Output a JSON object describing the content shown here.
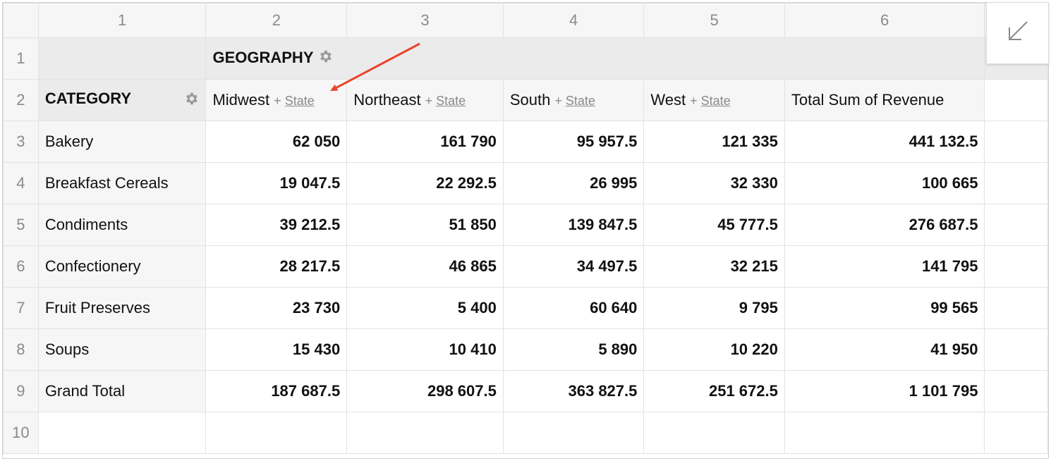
{
  "columns": [
    "1",
    "2",
    "3",
    "4",
    "5",
    "6"
  ],
  "rows": [
    "1",
    "2",
    "3",
    "4",
    "5",
    "6",
    "7",
    "8",
    "9",
    "10"
  ],
  "pivot": {
    "column_field": "GEOGRAPHY",
    "row_field": "CATEGORY",
    "column_headers": [
      {
        "label": "Midwest",
        "plus": "+",
        "sub": "State"
      },
      {
        "label": "Northeast",
        "plus": "+",
        "sub": "State"
      },
      {
        "label": "South",
        "plus": "+",
        "sub": "State"
      },
      {
        "label": "West",
        "plus": "+",
        "sub": "State"
      }
    ],
    "total_header": "Total Sum of Revenue",
    "data_rows": [
      {
        "label": "Bakery",
        "values": [
          "62 050",
          "161 790",
          "95 957.5",
          "121 335",
          "441 132.5"
        ]
      },
      {
        "label": "Breakfast Cereals",
        "values": [
          "19 047.5",
          "22 292.5",
          "26 995",
          "32 330",
          "100 665"
        ]
      },
      {
        "label": "Condiments",
        "values": [
          "39 212.5",
          "51 850",
          "139 847.5",
          "45 777.5",
          "276 687.5"
        ]
      },
      {
        "label": "Confectionery",
        "values": [
          "28 217.5",
          "46 865",
          "34 497.5",
          "32 215",
          "141 795"
        ]
      },
      {
        "label": "Fruit Preserves",
        "values": [
          "23 730",
          "5 400",
          "60 640",
          "9 795",
          "99 565"
        ]
      },
      {
        "label": "Soups",
        "values": [
          "15 430",
          "10 410",
          "5 890",
          "10 220",
          "41 950"
        ]
      }
    ],
    "grand_total": {
      "label": "Grand Total",
      "values": [
        "187 687.5",
        "298 607.5",
        "363 827.5",
        "251 672.5",
        "1 101 795"
      ]
    }
  },
  "icons": {
    "settings": "gear-icon",
    "collapse": "arrow-down-left-icon"
  },
  "colors": {
    "annotation_arrow": "#e8442c",
    "header_bg": "#ebebeb"
  }
}
